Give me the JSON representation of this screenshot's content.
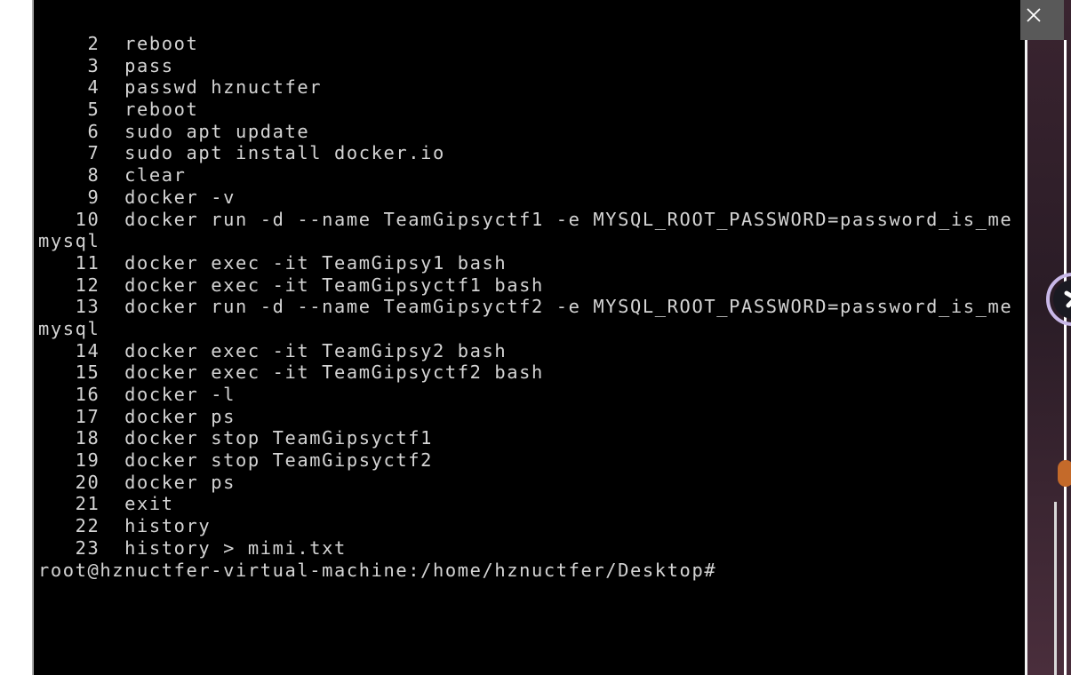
{
  "terminal": {
    "lines": [
      "    2  reboot",
      "    3  pass",
      "    4  passwd hznuctfer",
      "    5  reboot",
      "    6  sudo apt update",
      "    7  sudo apt install docker.io",
      "    8  clear",
      "    9  docker -v",
      "   10  docker run -d --name TeamGipsyctf1 -e MYSQL_ROOT_PASSWORD=password_is_me",
      "mysql",
      "   11  docker exec -it TeamGipsy1 bash",
      "   12  docker exec -it TeamGipsyctf1 bash",
      "   13  docker run -d --name TeamGipsyctf2 -e MYSQL_ROOT_PASSWORD=password_is_me",
      "mysql",
      "   14  docker exec -it TeamGipsy2 bash",
      "   15  docker exec -it TeamGipsyctf2 bash",
      "   16  docker -l",
      "   17  docker ps",
      "   18  docker stop TeamGipsyctf1",
      "   19  docker stop TeamGipsyctf2",
      "   20  docker ps",
      "   21  exit",
      "   22  history",
      "   23  history > mimi.txt",
      "root@hznuctfer-virtual-machine:/home/hznuctfer/Desktop#"
    ]
  },
  "window": {
    "close_icon": "close-icon"
  },
  "colors": {
    "terminal_bg": "#000000",
    "terminal_fg": "#d4d4d4",
    "close_bar": "#595959"
  }
}
